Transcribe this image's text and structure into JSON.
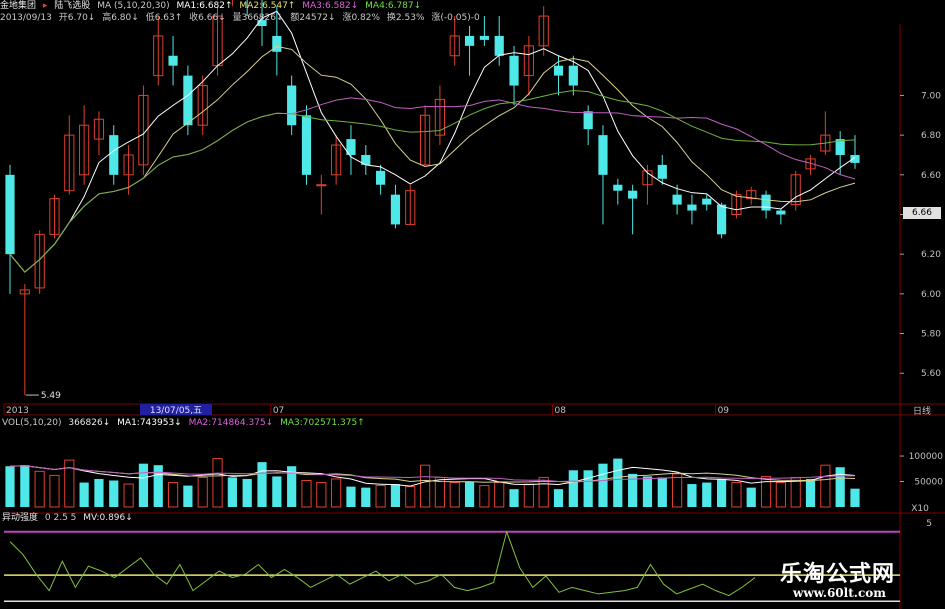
{
  "header": {
    "stock_name": "金地集团",
    "indicator_name": "陆飞选股",
    "ma_label": "MA (5,10,20,30)",
    "ma1": "MA1:6.682↑",
    "ma2": "MA2:6.547↑",
    "ma3": "MA3:6.582↓",
    "ma4": "MA4:6.787↓",
    "date": "2013/09/13",
    "open": "开6.70↓",
    "high": "高6.80↓",
    "low": "低6.63↑",
    "close": "收6.66↓",
    "volume": "量366826↓",
    "amount": "额24572↓",
    "change_pct": "涨0.82%",
    "turnover": "换2.53%",
    "extra": "涨(-0.05)-0"
  },
  "price_axis": {
    "ticks": [
      "7.00",
      "6.80",
      "6.60",
      "6.40",
      "6.20",
      "6.00",
      "5.80",
      "5.60"
    ],
    "current_price": "6.66",
    "low_marker": "5.49"
  },
  "time_axis": {
    "labels": [
      "2013",
      "07",
      "08",
      "09"
    ],
    "cursor_label": "13/07/05,五",
    "period": "日线"
  },
  "volume_panel": {
    "label": "VOL(5,10,20)",
    "value": "366826↓",
    "ma1": "MA1:743953↓",
    "ma2": "MA2:714864.375↓",
    "ma3": "MA3:702571.375↑",
    "ticks": [
      "100000",
      "50000"
    ],
    "unit": "X10"
  },
  "oscillator_panel": {
    "label": "异动强度",
    "params": "0 2.5 5",
    "mv": "MV:0.896↓",
    "tick": "5"
  },
  "watermark": {
    "title": "乐淘公式网",
    "url": "www.60lt.com"
  },
  "colors": {
    "up": "#e0402c",
    "down": "#4fe8e8",
    "ma1": "#ffffff",
    "ma2": "#d8d090",
    "ma3": "#c060c0",
    "ma4": "#70b040",
    "grid": "#800000",
    "osc_line": "#80c040",
    "osc_yellow": "#e8e870",
    "osc_purple": "#c040c0"
  },
  "chart_data": {
    "type": "candlestick",
    "price_range": [
      5.45,
      7.35
    ],
    "candles": [
      {
        "o": 6.6,
        "c": 6.2,
        "h": 6.65,
        "l": 6.0
      },
      {
        "o": 6.0,
        "c": 6.02,
        "h": 6.05,
        "l": 5.49
      },
      {
        "o": 6.03,
        "c": 6.3,
        "h": 6.32,
        "l": 6.0
      },
      {
        "o": 6.3,
        "c": 6.48,
        "h": 6.5,
        "l": 6.28
      },
      {
        "o": 6.52,
        "c": 6.8,
        "h": 6.9,
        "l": 6.5
      },
      {
        "o": 6.6,
        "c": 6.85,
        "h": 6.95,
        "l": 6.55
      },
      {
        "o": 6.78,
        "c": 6.88,
        "h": 6.92,
        "l": 6.7
      },
      {
        "o": 6.8,
        "c": 6.6,
        "h": 6.85,
        "l": 6.55
      },
      {
        "o": 6.6,
        "c": 6.7,
        "h": 6.75,
        "l": 6.5
      },
      {
        "o": 6.65,
        "c": 7.0,
        "h": 7.05,
        "l": 6.6
      },
      {
        "o": 7.1,
        "c": 7.3,
        "h": 7.4,
        "l": 7.05
      },
      {
        "o": 7.2,
        "c": 7.15,
        "h": 7.3,
        "l": 7.05
      },
      {
        "o": 7.1,
        "c": 6.85,
        "h": 7.15,
        "l": 6.8
      },
      {
        "o": 6.85,
        "c": 7.05,
        "h": 7.1,
        "l": 6.8
      },
      {
        "o": 7.15,
        "c": 7.4,
        "h": 7.45,
        "l": 7.1
      },
      {
        "o": 7.5,
        "c": 7.6,
        "h": 7.8,
        "l": 7.45
      },
      {
        "o": 7.75,
        "c": 7.55,
        "h": 7.85,
        "l": 7.4
      },
      {
        "o": 7.38,
        "c": 7.35,
        "h": 7.5,
        "l": 7.25
      },
      {
        "o": 7.3,
        "c": 7.22,
        "h": 7.45,
        "l": 7.1
      },
      {
        "o": 7.05,
        "c": 6.85,
        "h": 7.1,
        "l": 6.8
      },
      {
        "o": 6.9,
        "c": 6.6,
        "h": 6.95,
        "l": 6.55
      },
      {
        "o": 6.55,
        "c": 6.55,
        "h": 6.6,
        "l": 6.4
      },
      {
        "o": 6.6,
        "c": 6.75,
        "h": 6.8,
        "l": 6.55
      },
      {
        "o": 6.78,
        "c": 6.7,
        "h": 6.85,
        "l": 6.6
      },
      {
        "o": 6.7,
        "c": 6.65,
        "h": 6.75,
        "l": 6.6
      },
      {
        "o": 6.62,
        "c": 6.55,
        "h": 6.65,
        "l": 6.5
      },
      {
        "o": 6.5,
        "c": 6.35,
        "h": 6.55,
        "l": 6.33
      },
      {
        "o": 6.35,
        "c": 6.52,
        "h": 6.55,
        "l": 6.35
      },
      {
        "o": 6.65,
        "c": 6.9,
        "h": 6.95,
        "l": 6.65
      },
      {
        "o": 6.8,
        "c": 6.98,
        "h": 7.05,
        "l": 6.75
      },
      {
        "o": 7.2,
        "c": 7.3,
        "h": 7.4,
        "l": 7.15
      },
      {
        "o": 7.3,
        "c": 7.25,
        "h": 7.35,
        "l": 7.1
      },
      {
        "o": 7.3,
        "c": 7.28,
        "h": 7.4,
        "l": 7.25
      },
      {
        "o": 7.3,
        "c": 7.2,
        "h": 7.4,
        "l": 7.15
      },
      {
        "o": 7.2,
        "c": 7.05,
        "h": 7.25,
        "l": 6.95
      },
      {
        "o": 7.1,
        "c": 7.25,
        "h": 7.3,
        "l": 7.0
      },
      {
        "o": 7.25,
        "c": 7.4,
        "h": 7.45,
        "l": 7.2
      },
      {
        "o": 7.15,
        "c": 7.1,
        "h": 7.2,
        "l": 7.0
      },
      {
        "o": 7.15,
        "c": 7.05,
        "h": 7.2,
        "l": 7.0
      },
      {
        "o": 6.92,
        "c": 6.83,
        "h": 6.95,
        "l": 6.75
      },
      {
        "o": 6.8,
        "c": 6.6,
        "h": 6.85,
        "l": 6.35
      },
      {
        "o": 6.55,
        "c": 6.52,
        "h": 6.58,
        "l": 6.45
      },
      {
        "o": 6.52,
        "c": 6.48,
        "h": 6.55,
        "l": 6.3
      },
      {
        "o": 6.55,
        "c": 6.62,
        "h": 6.65,
        "l": 6.45
      },
      {
        "o": 6.65,
        "c": 6.58,
        "h": 6.7,
        "l": 6.55
      },
      {
        "o": 6.5,
        "c": 6.45,
        "h": 6.55,
        "l": 6.4
      },
      {
        "o": 6.45,
        "c": 6.42,
        "h": 6.5,
        "l": 6.35
      },
      {
        "o": 6.48,
        "c": 6.45,
        "h": 6.5,
        "l": 6.42
      },
      {
        "o": 6.45,
        "c": 6.3,
        "h": 6.46,
        "l": 6.28
      },
      {
        "o": 6.4,
        "c": 6.5,
        "h": 6.52,
        "l": 6.38
      },
      {
        "o": 6.48,
        "c": 6.52,
        "h": 6.54,
        "l": 6.45
      },
      {
        "o": 6.5,
        "c": 6.42,
        "h": 6.52,
        "l": 6.38
      },
      {
        "o": 6.42,
        "c": 6.4,
        "h": 6.43,
        "l": 6.35
      },
      {
        "o": 6.45,
        "c": 6.6,
        "h": 6.62,
        "l": 6.42
      },
      {
        "o": 6.63,
        "c": 6.68,
        "h": 6.7,
        "l": 6.6
      },
      {
        "o": 6.72,
        "c": 6.8,
        "h": 6.92,
        "l": 6.7
      },
      {
        "o": 6.78,
        "c": 6.7,
        "h": 6.82,
        "l": 6.6
      },
      {
        "o": 6.7,
        "c": 6.66,
        "h": 6.8,
        "l": 6.63
      }
    ],
    "volume_range": [
      0,
      155000
    ],
    "volumes": [
      {
        "v": 80000,
        "up": false
      },
      {
        "v": 82000,
        "up": false
      },
      {
        "v": 70000,
        "up": true
      },
      {
        "v": 62000,
        "up": true
      },
      {
        "v": 92000,
        "up": true
      },
      {
        "v": 48000,
        "up": false
      },
      {
        "v": 55000,
        "up": false
      },
      {
        "v": 52000,
        "up": false
      },
      {
        "v": 45000,
        "up": true
      },
      {
        "v": 85000,
        "up": false
      },
      {
        "v": 82000,
        "up": false
      },
      {
        "v": 48000,
        "up": true
      },
      {
        "v": 42000,
        "up": false
      },
      {
        "v": 58000,
        "up": true
      },
      {
        "v": 95000,
        "up": true
      },
      {
        "v": 58000,
        "up": false
      },
      {
        "v": 55000,
        "up": false
      },
      {
        "v": 88000,
        "up": false
      },
      {
        "v": 60000,
        "up": false
      },
      {
        "v": 80000,
        "up": false
      },
      {
        "v": 52000,
        "up": true
      },
      {
        "v": 48000,
        "up": true
      },
      {
        "v": 55000,
        "up": true
      },
      {
        "v": 40000,
        "up": false
      },
      {
        "v": 38000,
        "up": false
      },
      {
        "v": 42000,
        "up": true
      },
      {
        "v": 45000,
        "up": false
      },
      {
        "v": 40000,
        "up": true
      },
      {
        "v": 82000,
        "up": true
      },
      {
        "v": 58000,
        "up": true
      },
      {
        "v": 48000,
        "up": true
      },
      {
        "v": 50000,
        "up": false
      },
      {
        "v": 42000,
        "up": true
      },
      {
        "v": 48000,
        "up": true
      },
      {
        "v": 35000,
        "up": false
      },
      {
        "v": 45000,
        "up": true
      },
      {
        "v": 58000,
        "up": true
      },
      {
        "v": 35000,
        "up": false
      },
      {
        "v": 72000,
        "up": false
      },
      {
        "v": 72000,
        "up": false
      },
      {
        "v": 85000,
        "up": false
      },
      {
        "v": 95000,
        "up": false
      },
      {
        "v": 65000,
        "up": false
      },
      {
        "v": 60000,
        "up": false
      },
      {
        "v": 58000,
        "up": false
      },
      {
        "v": 65000,
        "up": true
      },
      {
        "v": 45000,
        "up": false
      },
      {
        "v": 48000,
        "up": false
      },
      {
        "v": 55000,
        "up": false
      },
      {
        "v": 48000,
        "up": true
      },
      {
        "v": 38000,
        "up": false
      },
      {
        "v": 60000,
        "up": true
      },
      {
        "v": 48000,
        "up": true
      },
      {
        "v": 58000,
        "up": true
      },
      {
        "v": 55000,
        "up": false
      },
      {
        "v": 82000,
        "up": true
      },
      {
        "v": 78000,
        "up": false
      },
      {
        "v": 36000,
        "up": false
      }
    ],
    "oscillator": [
      4.0,
      3.2,
      2.0,
      1.0,
      2.8,
      1.2,
      2.5,
      2.2,
      1.8,
      2.4,
      3.0,
      2.0,
      1.4,
      2.6,
      1.0,
      1.6,
      2.2,
      1.8,
      2.0,
      2.6,
      1.8,
      2.3,
      1.8,
      1.2,
      1.6,
      2.0,
      1.4,
      1.8,
      2.2,
      1.6,
      2.0,
      1.4,
      1.6,
      2.0,
      1.2,
      1.0,
      1.2,
      1.5,
      4.6,
      2.4,
      1.2,
      1.9,
      0.9,
      1.2,
      1.0,
      0.8,
      0.9,
      1.0,
      1.2,
      2.6,
      1.4,
      0.8,
      1.1,
      1.4,
      1.0,
      0.7,
      1.2,
      1.8
    ],
    "oscillator_range": [
      0,
      5.2
    ],
    "osc_levels": {
      "purple": 4.6,
      "yellow": 1.95,
      "white": 0.35
    }
  }
}
